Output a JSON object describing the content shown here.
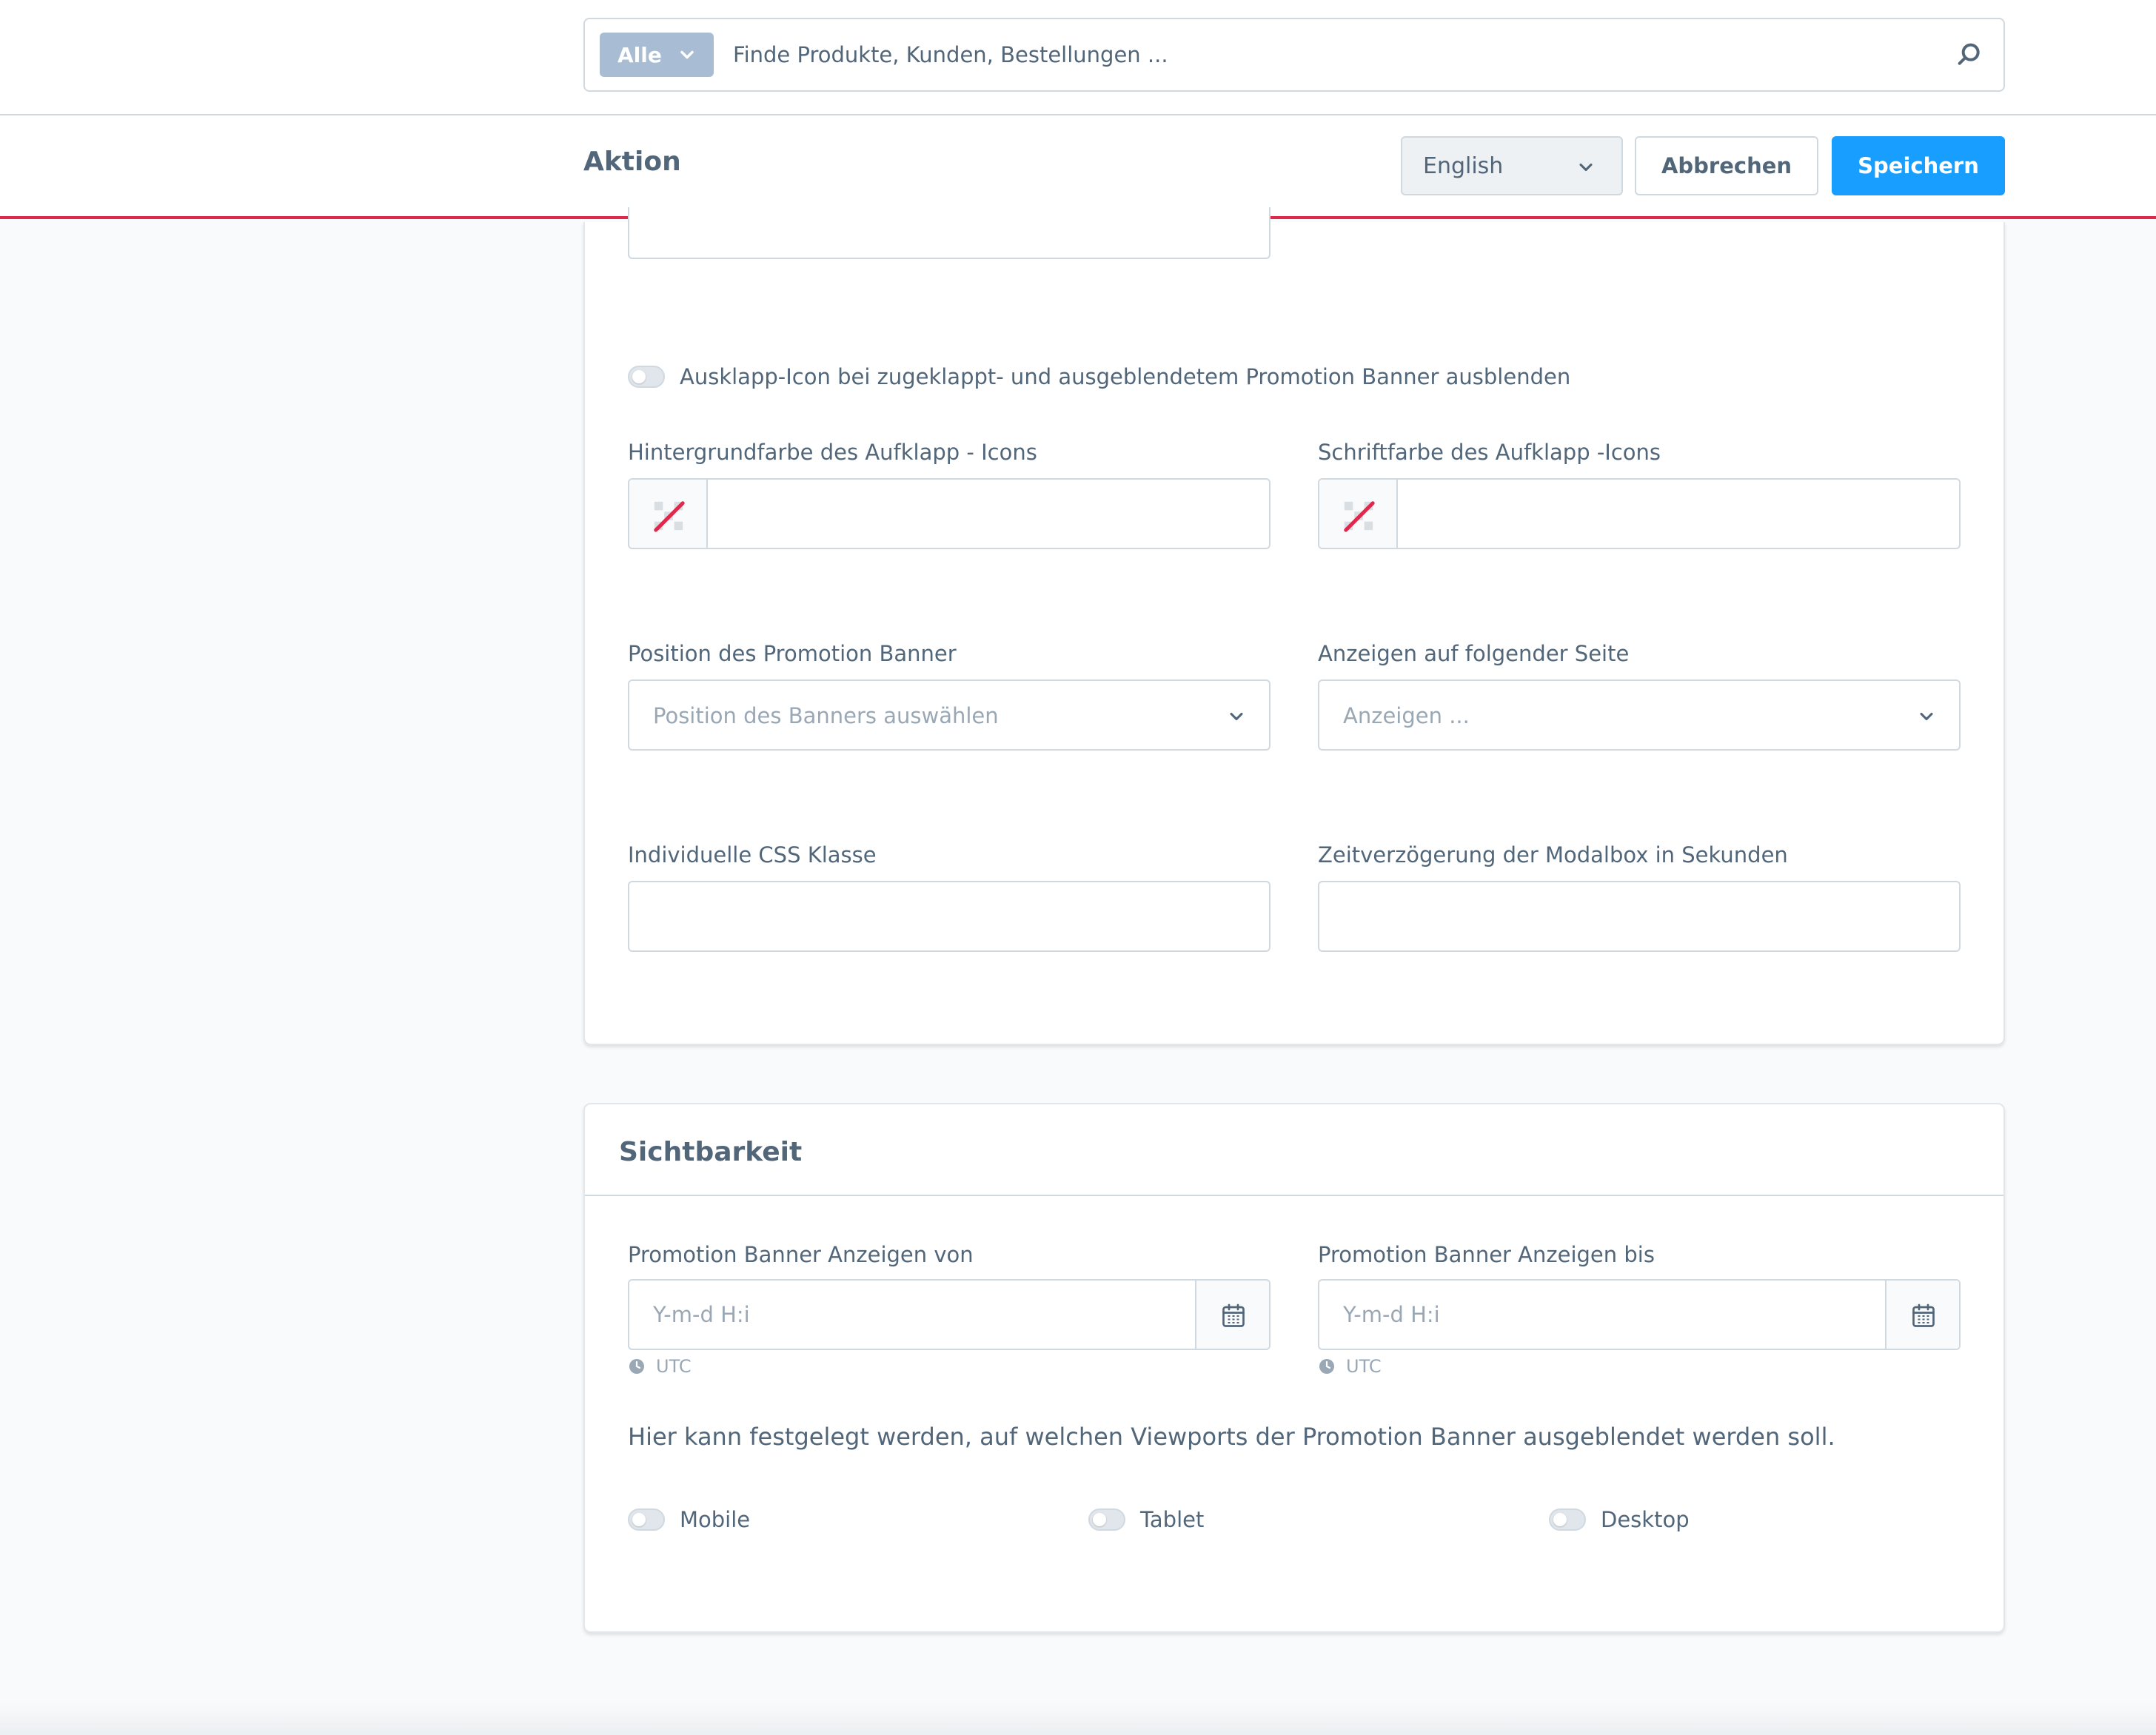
{
  "search": {
    "type_label": "Alle",
    "placeholder": "Finde Produkte, Kunden, Bestellungen ..."
  },
  "smartbar": {
    "title": "Aktion",
    "language": "English",
    "cancel_label": "Abbrechen",
    "save_label": "Speichern"
  },
  "settings": {
    "hide_icon_toggle_label": "Ausklapp-Icon bei zugeklappt- und ausgeblendetem Promotion Banner ausblenden",
    "icon_bg_color_label": "Hintergrundfarbe des Aufklapp - Icons",
    "icon_font_color_label": "Schriftfarbe des Aufklapp -Icons",
    "position_label": "Position des Promotion Banner",
    "position_placeholder": "Position des Banners auswählen",
    "show_on_page_label": "Anzeigen auf folgender Seite",
    "show_on_page_placeholder": "Anzeigen ...",
    "css_class_label": "Individuelle CSS Klasse",
    "delay_label": "Zeitverzögerung der Modalbox in Sekunden"
  },
  "visibility": {
    "title": "Sichtbarkeit",
    "from_label": "Promotion Banner Anzeigen von",
    "to_label": "Promotion Banner Anzeigen bis",
    "date_placeholder": "Y-m-d H:i",
    "timezone": "UTC",
    "viewport_help": "Hier kann festgelegt werden, auf welchen Viewports der Promotion Banner ausgeblendet werden soll.",
    "viewports": [
      {
        "label": "Mobile"
      },
      {
        "label": "Tablet"
      },
      {
        "label": "Desktop"
      }
    ]
  },
  "colors": {
    "primary": "#189eff",
    "danger": "#de294c",
    "text": "#52667a",
    "muted": "#9aa8b5",
    "border": "#d1d9e0"
  }
}
